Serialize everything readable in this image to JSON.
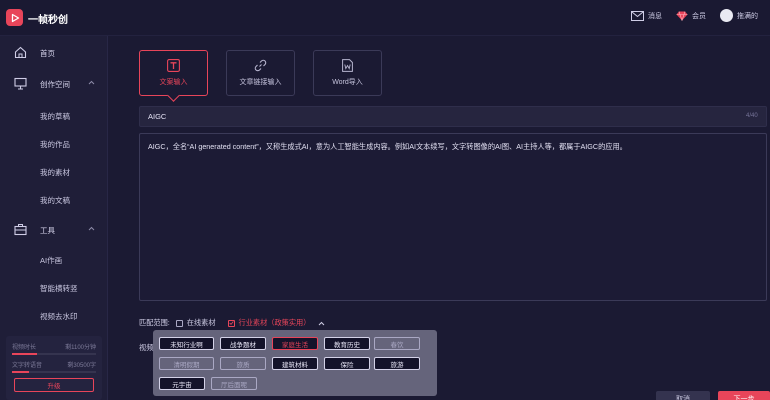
{
  "app": {
    "title": "一帧秒创"
  },
  "header": {
    "messages_label": "消息",
    "member_label": "会员",
    "username": "拖满的"
  },
  "sidebar": {
    "home": "首页",
    "creation_space": "创作空间",
    "creation_items": [
      "我的草稿",
      "我的作品",
      "我的素材",
      "我的文稿"
    ],
    "tools": "工具",
    "tool_items": [
      "AI作画",
      "智能横转竖",
      "视频去水印"
    ],
    "quota": {
      "video_label": "视频时长",
      "video_value": "剩1100分钟",
      "text_label": "文字转语音",
      "text_value": "剩30500字",
      "video_fraction": 0.3,
      "text_fraction": 0.2
    },
    "upgrade_label": "升级"
  },
  "tabs": [
    {
      "label": "文案输入",
      "active": true
    },
    {
      "label": "文章链接输入",
      "active": false
    },
    {
      "label": "Word导入",
      "active": false
    }
  ],
  "editor": {
    "title_value": "AIGC",
    "title_count": "4/40",
    "content": "AIGC，全名“AI generated content”，又称生成式AI，意为人工智能生成内容。例如AI文本续写，文字转图像的AI图、AI主持人等，都属于AIGC的应用。"
  },
  "match": {
    "label": "匹配范围:",
    "online_label": "在线素材",
    "industry_label": "行业素材（政策实用）"
  },
  "video_label": "视频",
  "categories": [
    {
      "label": "未知行业啊",
      "state": "on"
    },
    {
      "label": "战争题材",
      "state": "on"
    },
    {
      "label": "家庭生活",
      "state": "sel"
    },
    {
      "label": "教育历史",
      "state": "on"
    },
    {
      "label": "春饮",
      "state": "off"
    },
    {
      "label": "清明假期",
      "state": "off"
    },
    {
      "label": "旅质",
      "state": "off"
    },
    {
      "label": "建筑材料",
      "state": "on"
    },
    {
      "label": "保险",
      "state": "on"
    },
    {
      "label": "旅游",
      "state": "on"
    },
    {
      "label": "元宇宙",
      "state": "on"
    },
    {
      "label": "厅后面呢",
      "state": "off"
    }
  ],
  "buttons": {
    "cancel": "取消",
    "next": "下一步"
  },
  "colors": {
    "accent": "#e8455a",
    "background": "#1b1a33",
    "sidebar": "#1f1e38"
  }
}
